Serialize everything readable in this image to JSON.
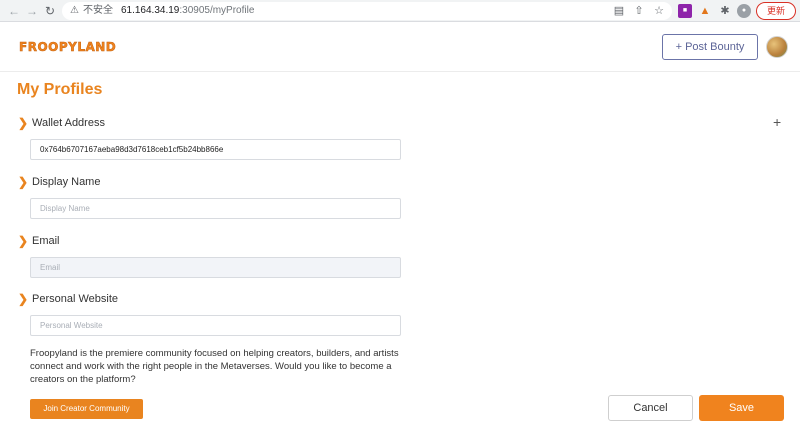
{
  "browser": {
    "insecure_label": "不安全",
    "url_host": "61.164.34.19",
    "url_path": ":30905/myProfile",
    "update_label": "更新"
  },
  "header": {
    "logo_text": "FROOPYLAND",
    "post_bounty_label": "+ Post Bounty"
  },
  "page": {
    "title": "My Profiles"
  },
  "wallet": {
    "label": "Wallet Address",
    "value": "0x764b6707167aeba98d3d7618ceb1cf5b24bb866e"
  },
  "display_name": {
    "label": "Display Name",
    "placeholder": "Display Name"
  },
  "email": {
    "label": "Email",
    "placeholder": "Email"
  },
  "website": {
    "label": "Personal Website",
    "placeholder": "Personal Website"
  },
  "promo": {
    "text": "Froopyland is the premiere community focused on helping creators, builders, and artists connect and work with the right people in the Metaverses. Would you like to become a creators on the platform?",
    "join_label": "Join Creator Community"
  },
  "actions": {
    "cancel_label": "Cancel",
    "save_label": "Save"
  },
  "colors": {
    "accent": "#f0831e",
    "secondary": "#6b74a8"
  }
}
